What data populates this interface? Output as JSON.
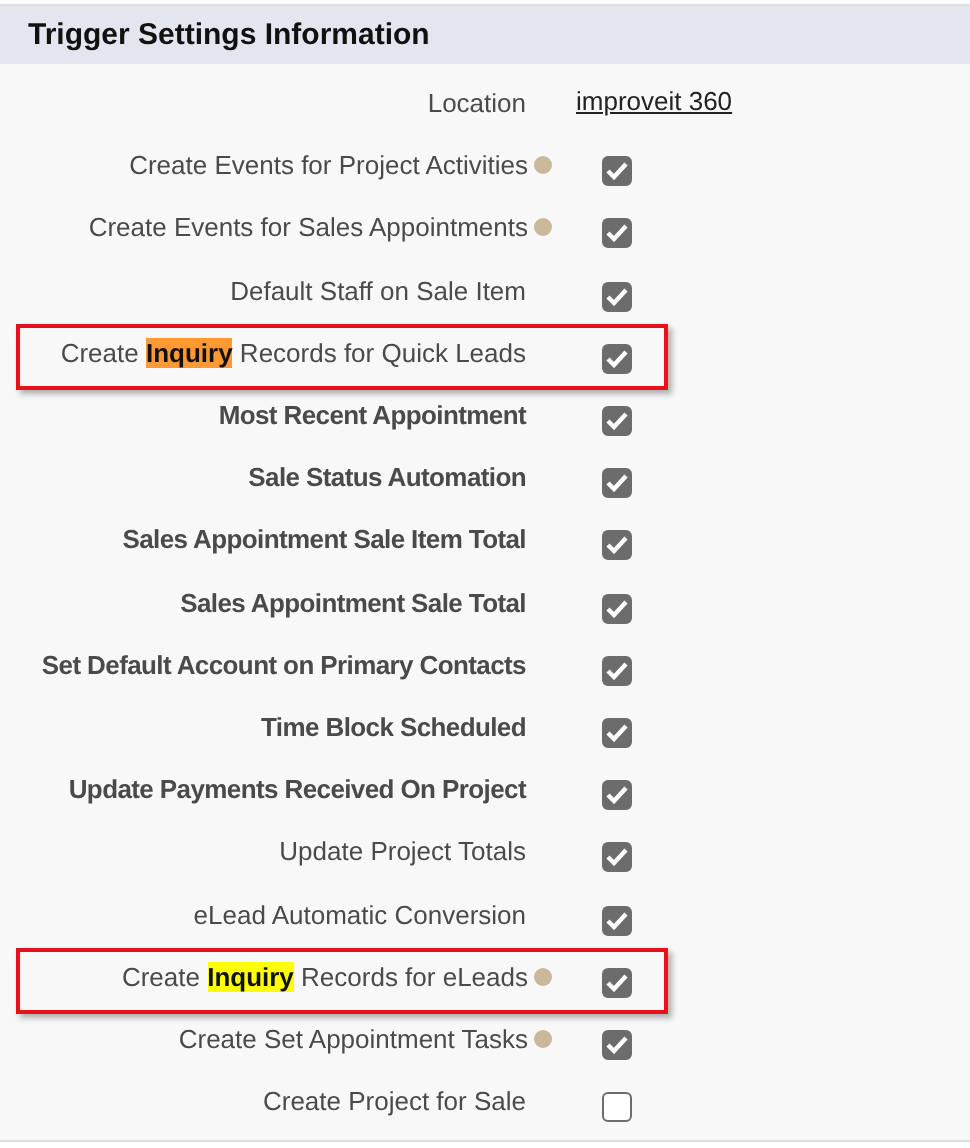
{
  "section": {
    "title": "Trigger Settings Information"
  },
  "rows": [
    {
      "kind": "link",
      "label": "Location",
      "value": "improveit 360"
    },
    {
      "kind": "checkbox",
      "label": "Create Events for Project Activities",
      "help": true,
      "checked": true
    },
    {
      "kind": "checkbox",
      "label": "Create Events for Sales Appointments",
      "help": true,
      "checked": true
    },
    {
      "kind": "checkbox",
      "label": "Default Staff on Sale Item",
      "checked": true
    },
    {
      "kind": "checkbox",
      "label": "Create **Inquiry** Records for Quick Leads",
      "checked": true,
      "boxed": true,
      "color": "#ff9933"
    },
    {
      "kind": "checkbox",
      "label": "Most Recent Appointment",
      "checked": true,
      "emphasis": true
    },
    {
      "kind": "checkbox",
      "label": "Sale Status Automation",
      "checked": true,
      "emphasis": true
    },
    {
      "kind": "checkbox",
      "label": "Sales Appointment Sale Item Total",
      "checked": true,
      "emphasis": true
    },
    {
      "kind": "checkbox",
      "label": "Sales Appointment Sale Total",
      "checked": true,
      "emphasis": true
    },
    {
      "kind": "checkbox",
      "label": "Set Default Account on Primary Contacts",
      "checked": true,
      "emphasis": true
    },
    {
      "kind": "checkbox",
      "label": "Time Block Scheduled",
      "checked": true,
      "emphasis": true
    },
    {
      "kind": "checkbox",
      "label": "Update Payments Received On Project",
      "checked": true,
      "emphasis": true
    },
    {
      "kind": "checkbox",
      "label": "Update Project Totals",
      "checked": true
    },
    {
      "kind": "checkbox",
      "label": "eLead Automatic Conversion",
      "checked": true
    },
    {
      "kind": "checkbox",
      "label": "Create **Inquiry** Records for eLeads",
      "help": true,
      "checked": true,
      "boxed": true,
      "color": "#ffff00"
    },
    {
      "kind": "checkbox",
      "label": "Create Set Appointment Tasks",
      "help": true,
      "checked": true
    },
    {
      "kind": "checkbox",
      "label": "Create Project for Sale",
      "checked": false
    }
  ]
}
